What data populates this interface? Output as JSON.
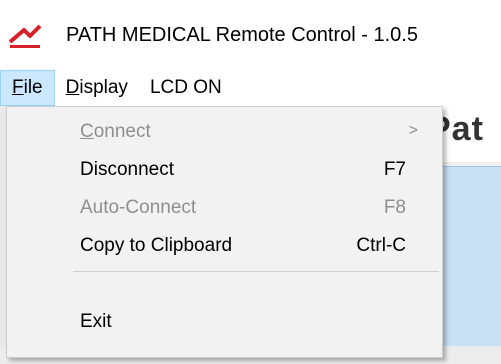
{
  "window": {
    "title": "PATH MEDICAL Remote Control  -  1.0.5"
  },
  "menubar": {
    "items": [
      {
        "label": "File",
        "underline": "F",
        "rest": "ile"
      },
      {
        "label": "Display",
        "underline": "D",
        "rest": "isplay"
      },
      {
        "label": "LCD ON"
      }
    ]
  },
  "file_menu": {
    "items": [
      {
        "label": "Connect",
        "underline": "C",
        "rest": "onnect",
        "shortcut": "",
        "enabled": false,
        "submenu": true
      },
      {
        "label": "Disconnect",
        "shortcut": "F7",
        "enabled": true
      },
      {
        "label": "Auto-Connect",
        "shortcut": "F8",
        "enabled": false
      },
      {
        "label": "Copy to Clipboard",
        "shortcut": "Ctrl-C",
        "enabled": true
      },
      {
        "label": "Exit",
        "shortcut": "",
        "enabled": true
      }
    ],
    "submenu_arrow": ">"
  },
  "background": {
    "heading_fragment": "Pat"
  },
  "colors": {
    "brand_red": "#d6202a",
    "menu_highlight": "#cce8ff",
    "disabled_text": "#8f8f8f"
  }
}
